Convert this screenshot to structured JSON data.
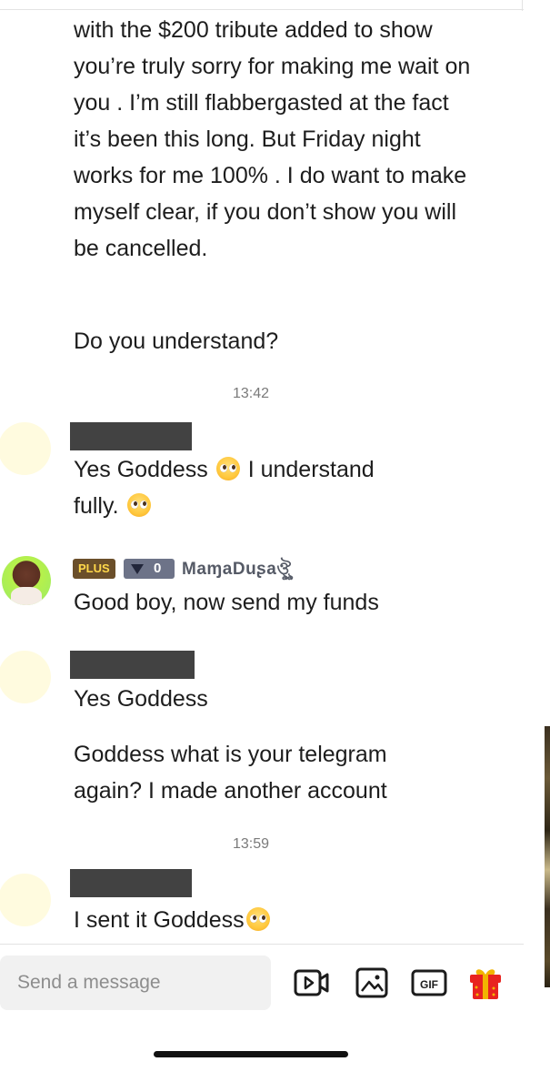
{
  "messages": {
    "m1": "with the $200 tribute added to show you’re truly sorry for making me wait on you . I’m still flabbergasted at the fact it’s been this long. But Friday night works for me 100% . I do want to make myself clear, if you don’t show you will be cancelled.",
    "m2": "Do you understand?",
    "t1": "13:42",
    "m3_part1": "Yes Goddess",
    "m3_part2": "I understand",
    "m3_part3": "fully.",
    "sender_badge": "PLUS",
    "sender_level": "0",
    "sender_name": "MaɱaDuʂaঔৣ",
    "m4": "Good boy, now send my funds",
    "m5": "Yes Goddess",
    "m6": "Goddess what is your telegram again? I made another account",
    "t2": "13:59",
    "m7": "I sent it Goddess"
  },
  "composer": {
    "placeholder": "Send a message"
  },
  "icons": {
    "video": "video-camera-icon",
    "image": "image-icon",
    "gif": "gif-icon",
    "gift": "gift-icon",
    "emoji": "pleading-face-emoji"
  }
}
